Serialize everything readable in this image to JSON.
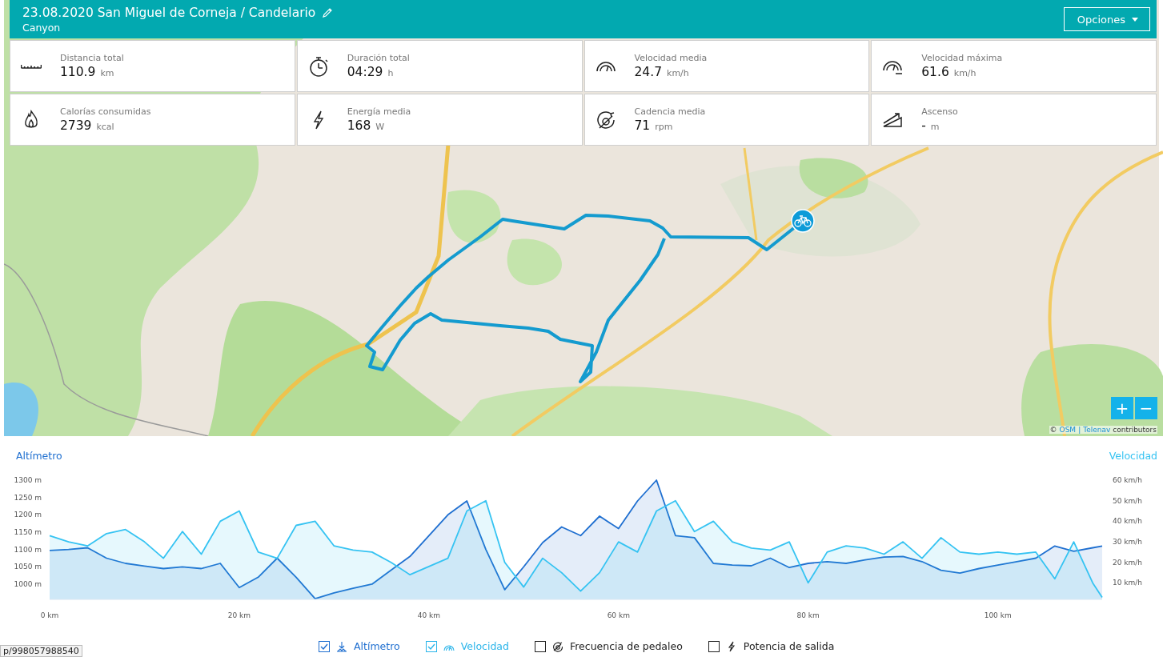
{
  "header": {
    "title": "23.08.2020 San Miguel de Corneja / Candelario",
    "subtitle": "Canyon",
    "options_button": "Opciones"
  },
  "stats": [
    {
      "kind": "distance",
      "label": "Distancia total",
      "value": "110.9",
      "unit": "km"
    },
    {
      "kind": "duration",
      "label": "Duración total",
      "value": "04:29",
      "unit": "h"
    },
    {
      "kind": "avg_speed",
      "label": "Velocidad media",
      "value": "24.7",
      "unit": "km/h"
    },
    {
      "kind": "max_speed",
      "label": "Velocidad máxima",
      "value": "61.6",
      "unit": "km/h"
    },
    {
      "kind": "calories",
      "label": "Calorías consumidas",
      "value": "2739",
      "unit": "kcal"
    },
    {
      "kind": "power",
      "label": "Energía media",
      "value": "168",
      "unit": "W"
    },
    {
      "kind": "cadence",
      "label": "Cadencia media",
      "value": "71",
      "unit": "rpm"
    },
    {
      "kind": "ascent",
      "label": "Ascenso",
      "value": "-",
      "unit": "m"
    }
  ],
  "map": {
    "kind": "picture",
    "zoom_in": "+",
    "zoom_out": "−",
    "attribution": {
      "prefix": "©",
      "links": [
        "OSM",
        "Telenav"
      ],
      "separator": "|",
      "suffix": "contributors"
    }
  },
  "chart": {
    "chart_data": {
      "type": "area",
      "xlim": [
        0,
        111
      ],
      "ylim": [
        956,
        1300
      ],
      "y2lim": [
        2,
        60
      ],
      "x": [
        0,
        2,
        4,
        6,
        8,
        10,
        12,
        14,
        16,
        18,
        20,
        22,
        24,
        26,
        28,
        30,
        32,
        34,
        36,
        38,
        40,
        42,
        44,
        46,
        48,
        50,
        52,
        54,
        56,
        58,
        60,
        62,
        64,
        66,
        68,
        70,
        72,
        74,
        76,
        78,
        80,
        82,
        84,
        86,
        88,
        90,
        92,
        94,
        96,
        98,
        100,
        102,
        104,
        106,
        108,
        110,
        111
      ],
      "xticks": [
        {
          "value": 0,
          "label": "0 km"
        },
        {
          "value": 20,
          "label": "20 km"
        },
        {
          "value": 40,
          "label": "40 km"
        },
        {
          "value": 60,
          "label": "60 km"
        },
        {
          "value": 80,
          "label": "80 km"
        },
        {
          "value": 100,
          "label": "100 km"
        }
      ],
      "yticks": [
        {
          "value": 1000,
          "label": "1000 m"
        },
        {
          "value": 1050,
          "label": "1050 m"
        },
        {
          "value": 1100,
          "label": "1100 m"
        },
        {
          "value": 1150,
          "label": "1150 m"
        },
        {
          "value": 1200,
          "label": "1200 m"
        },
        {
          "value": 1250,
          "label": "1250 m"
        },
        {
          "value": 1300,
          "label": "1300 m"
        }
      ],
      "y2ticks": [
        {
          "value": 10,
          "label": "10 km/h"
        },
        {
          "value": 20,
          "label": "20 km/h"
        },
        {
          "value": 30,
          "label": "30 km/h"
        },
        {
          "value": 40,
          "label": "40 km/h"
        },
        {
          "value": 50,
          "label": "50 km/h"
        },
        {
          "value": 60,
          "label": "60 km/h"
        }
      ],
      "series": [
        {
          "name": "Altímetro",
          "color": "#1f6fd0",
          "values": [
            1097,
            1100,
            1105,
            1075,
            1060,
            1052,
            1045,
            1050,
            1045,
            1060,
            990,
            1020,
            1075,
            1020,
            958,
            975,
            988,
            1000,
            1040,
            1080,
            1140,
            1200,
            1240,
            1100,
            984,
            1050,
            1120,
            1165,
            1140,
            1196,
            1160,
            1240,
            1300,
            1140,
            1134,
            1060,
            1055,
            1053,
            1075,
            1048,
            1060,
            1065,
            1060,
            1070,
            1078,
            1080,
            1065,
            1040,
            1032,
            1045,
            1055,
            1065,
            1075,
            1110,
            1095,
            1105,
            1110
          ]
        },
        {
          "name": "Velocidad",
          "color": "#35c3f2",
          "axis": "y2",
          "values": [
            33,
            30,
            28,
            34,
            36,
            30,
            22,
            35,
            24,
            40,
            45,
            25,
            22,
            38,
            40,
            28,
            26,
            25,
            20,
            14,
            18,
            22,
            45,
            50,
            20,
            8,
            22,
            15,
            6,
            15,
            30,
            25,
            45,
            50,
            35,
            40,
            30,
            27,
            26,
            30,
            10,
            25,
            28,
            27,
            24,
            30,
            22,
            32,
            25,
            24,
            25,
            24,
            25,
            12,
            30,
            10,
            3
          ]
        }
      ]
    },
    "legend": [
      {
        "kind": "altitude",
        "label": "Altímetro",
        "checked": true,
        "color": "#1f6fd0"
      },
      {
        "kind": "speed",
        "label": "Velocidad",
        "checked": true,
        "color": "#2bb5ea"
      },
      {
        "kind": "cadence",
        "label": "Frecuencia de pedaleo",
        "checked": false
      },
      {
        "kind": "power",
        "label": "Potencia de salida",
        "checked": false
      }
    ]
  },
  "status_url": "p/998057988540"
}
